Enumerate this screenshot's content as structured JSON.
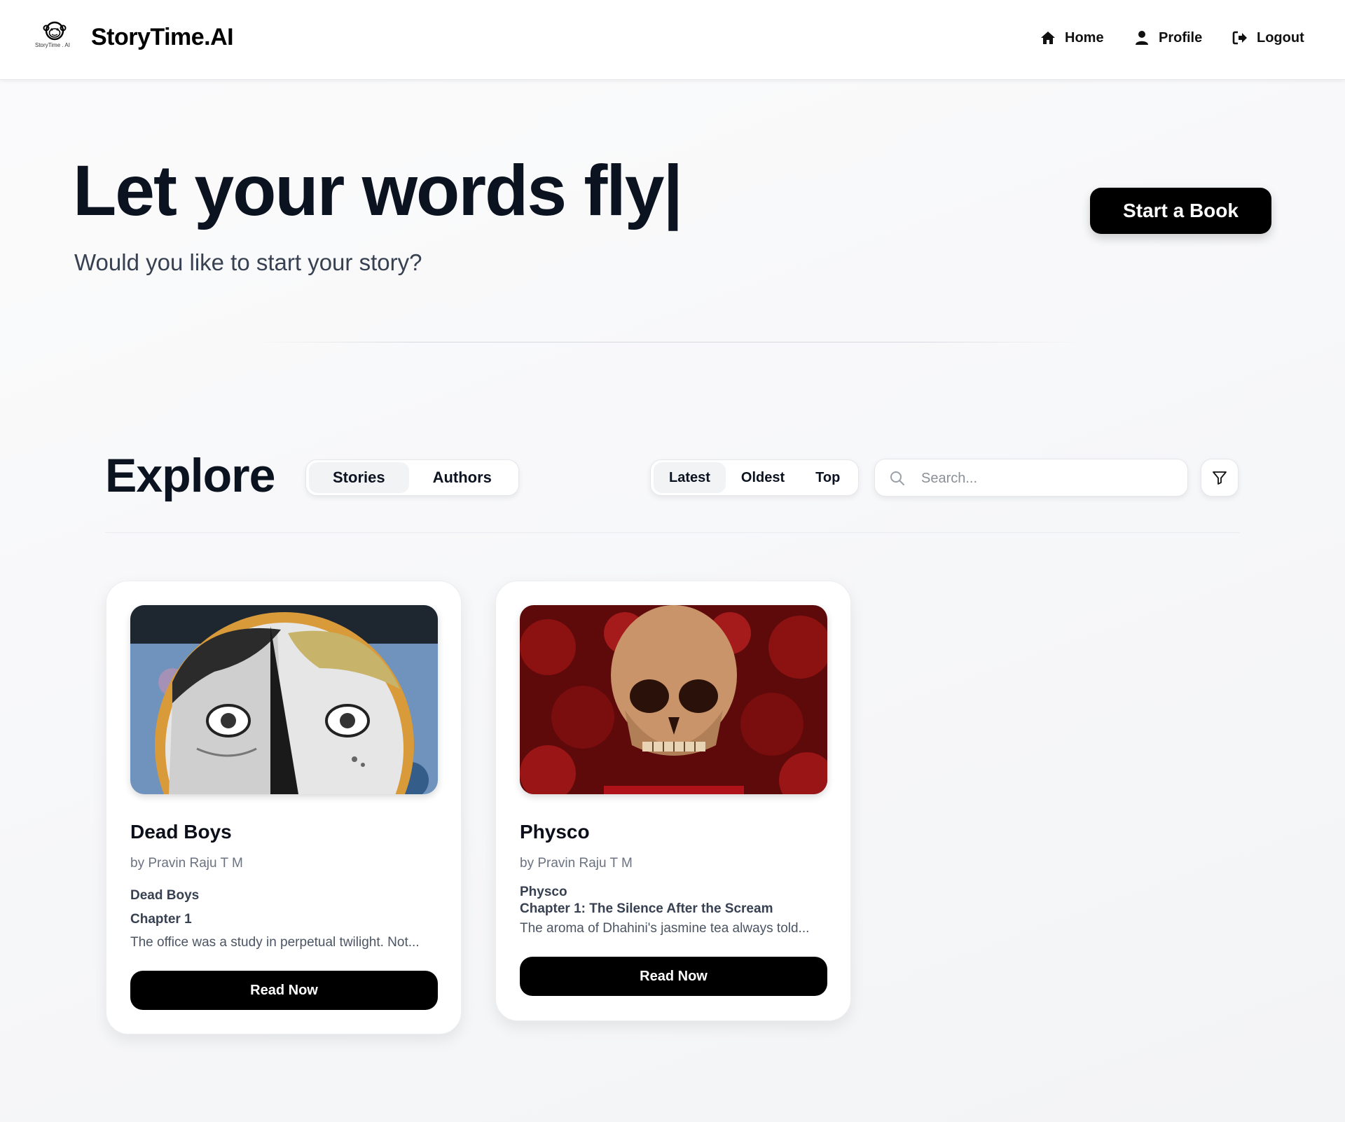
{
  "nav": {
    "logo_text": "StoryTime . AI",
    "brand_name": "StoryTime.AI",
    "links": [
      {
        "label": "Home",
        "icon": "home-icon"
      },
      {
        "label": "Profile",
        "icon": "user-icon"
      },
      {
        "label": "Logout",
        "icon": "logout-icon"
      }
    ]
  },
  "hero": {
    "title": "Let your words fly|",
    "subtitle": "Would you like to start your story?",
    "cta_label": "Start a Book"
  },
  "explore": {
    "title": "Explore",
    "type_tabs": [
      {
        "label": "Stories",
        "active": true
      },
      {
        "label": "Authors",
        "active": false
      }
    ],
    "sort_tabs": [
      {
        "label": "Latest",
        "active": true
      },
      {
        "label": "Oldest",
        "active": false
      },
      {
        "label": "Top",
        "active": false
      }
    ],
    "search_placeholder": "Search...",
    "filter_icon": "filter-icon"
  },
  "stories": [
    {
      "title": "Dead Boys",
      "author": "by Pravin Raju T M",
      "book_heading": "Dead Boys",
      "chapter": "Chapter 1",
      "excerpt": "The office was a study in perpetual twilight. Not...",
      "button_label": "Read Now"
    },
    {
      "title": "Physco",
      "author": "by Pravin Raju T M",
      "book_heading": "Physco",
      "chapter": "Chapter 1: The Silence After the Scream",
      "excerpt": "The aroma of Dhahini's jasmine tea always told...",
      "button_label": "Read Now"
    }
  ],
  "colors": {
    "primary": "#000000",
    "text": "#0b1220",
    "muted": "#6b7280",
    "background": "#f6f7f8"
  }
}
